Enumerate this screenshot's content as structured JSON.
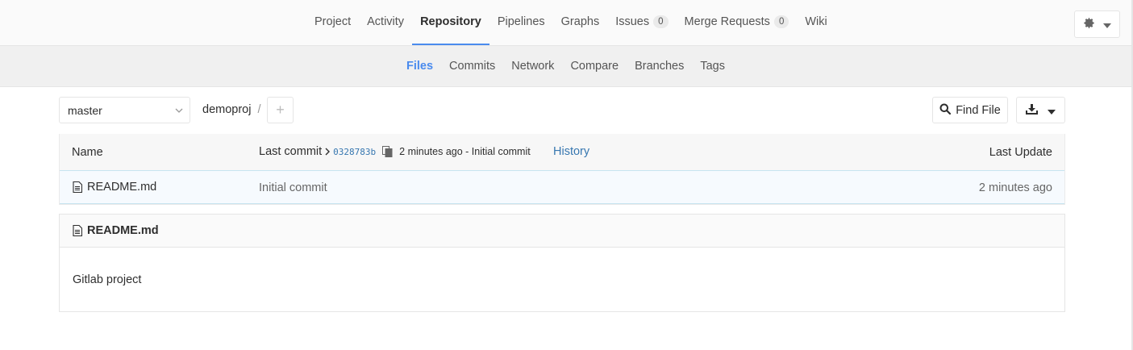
{
  "top_nav": {
    "items": [
      {
        "label": "Project"
      },
      {
        "label": "Activity"
      },
      {
        "label": "Repository"
      },
      {
        "label": "Pipelines"
      },
      {
        "label": "Graphs"
      },
      {
        "label": "Issues",
        "count": "0"
      },
      {
        "label": "Merge Requests",
        "count": "0"
      },
      {
        "label": "Wiki"
      }
    ],
    "active": "Repository"
  },
  "sub_nav": {
    "items": [
      {
        "label": "Files"
      },
      {
        "label": "Commits"
      },
      {
        "label": "Network"
      },
      {
        "label": "Compare"
      },
      {
        "label": "Branches"
      },
      {
        "label": "Tags"
      }
    ],
    "active": "Files"
  },
  "toolbar": {
    "branch": "master",
    "breadcrumb_project": "demoproj",
    "breadcrumb_sep": "/",
    "add_label": "+",
    "find_file_label": "Find File"
  },
  "tree": {
    "header": {
      "name": "Name",
      "last_commit": "Last commit",
      "sha": "0328783b",
      "commit_desc": "2 minutes ago - Initial commit",
      "history": "History",
      "last_update": "Last Update"
    },
    "rows": [
      {
        "name": "README.md",
        "commit": "Initial commit",
        "updated": "2 minutes ago"
      }
    ]
  },
  "readme": {
    "title": "README.md",
    "content": "Gitlab project"
  },
  "colors": {
    "accent": "#4a8bee",
    "link": "#3777b0"
  }
}
